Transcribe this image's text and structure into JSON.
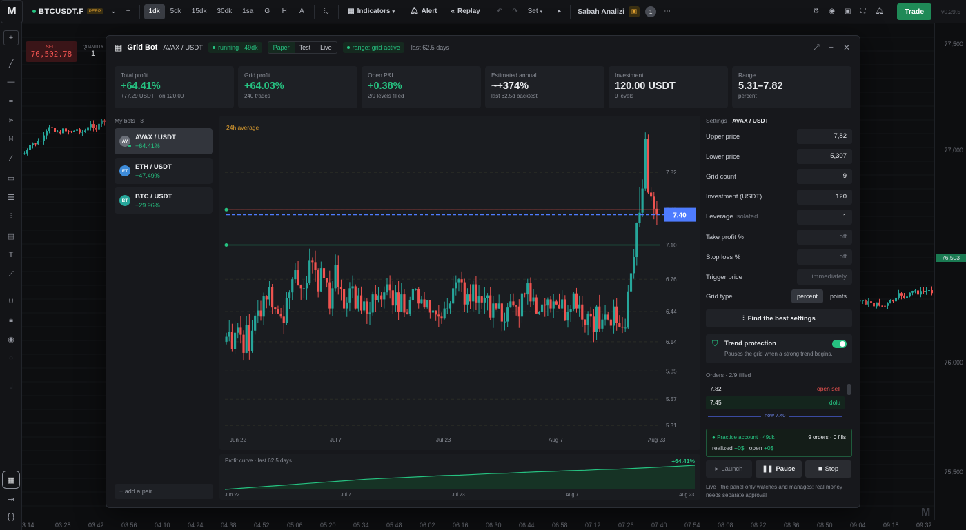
{
  "colors": {
    "up": "#26a69a",
    "down": "#ef5350",
    "accent": "#26c281",
    "blue": "#4e7cff",
    "bg": "#0d0e10"
  },
  "topbar": {
    "logo": "M",
    "symbol": "BTCUSDT.F",
    "symbol_badge": "PERP",
    "intervals": [
      "1dk",
      "5dk",
      "15dk",
      "30dk",
      "1sa",
      "G",
      "H",
      "A"
    ],
    "active_interval": "1dk",
    "indicators": "Indicators",
    "alert": "Alert",
    "replay": "Replay",
    "set": "Set",
    "layout_name": "Sabah Analizi",
    "layout_badge": "1",
    "trade": "Trade",
    "version": "v0.29.5"
  },
  "order_widget": {
    "sell_label": "SELL",
    "sell_price": "76,502.78",
    "qty_label": "QUANTITY",
    "qty_value": "1"
  },
  "price_axis": {
    "labels": [
      "77,500",
      "77,000",
      "76,500",
      "76,000",
      "75,500"
    ],
    "current": "76,503"
  },
  "time_axis": [
    "3:14",
    "03:28",
    "03:42",
    "03:56",
    "04:10",
    "04:24",
    "04:38",
    "04:52",
    "05:06",
    "05:20",
    "05:34",
    "05:48",
    "06:02",
    "06:16",
    "06:30",
    "06:44",
    "06:58",
    "07:12",
    "07:26",
    "07:40",
    "07:54",
    "08:08",
    "08:22",
    "08:36",
    "08:50",
    "09:04",
    "09:18",
    "09:32"
  ],
  "modal": {
    "title": "Grid Bot",
    "pair": "AVAX / USDT",
    "status": "running · 49dk",
    "modes": [
      "Paper",
      "Test",
      "Live"
    ],
    "active_mode": "Paper",
    "range_status": "range: grid active",
    "period": "last 62.5 days",
    "stats": [
      {
        "label": "Total profit",
        "value": "+64.41%",
        "sub": "+77.29 USDT · on 120.00",
        "color": "#26c281"
      },
      {
        "label": "Grid profit",
        "value": "+64.03%",
        "sub": "240 trades",
        "color": "#26c281"
      },
      {
        "label": "Open P&L",
        "value": "+0.38%",
        "sub": "2/9 levels filled",
        "color": "#26c281"
      },
      {
        "label": "Estimated annual",
        "value": "~+374%",
        "sub": "last 62.5d backtest",
        "color": "#e8eaed"
      },
      {
        "label": "Investment",
        "value": "120.00 USDT",
        "sub": "9 levels",
        "color": "#e8eaed"
      },
      {
        "label": "Range",
        "value": "5.31–7.82",
        "sub": "percent",
        "color": "#e8eaed"
      }
    ],
    "bots_header": "My bots · 3",
    "bots": [
      {
        "abbr": "AV",
        "name": "AVAX / USDT",
        "profit": "+64.41%",
        "color": "#6b6f78",
        "active": true
      },
      {
        "abbr": "ET",
        "name": "ETH / USDT",
        "profit": "+47.49%",
        "color": "#3d8bd9",
        "active": false
      },
      {
        "abbr": "BT",
        "name": "BTC / USDT",
        "profit": "+29.96%",
        "color": "#26a69a",
        "active": false
      }
    ],
    "add_pair": "+ add a pair",
    "settings_header": "Settings ·",
    "settings_pair": "AVAX / USDT",
    "fields": [
      {
        "label": "Upper price",
        "value": "7,82",
        "muted": false
      },
      {
        "label": "Lower price",
        "value": "5,307",
        "muted": false
      },
      {
        "label": "Grid count",
        "value": "9",
        "muted": false
      },
      {
        "label": "Investment (USDT)",
        "value": "120",
        "muted": false
      },
      {
        "label": "Leverage",
        "value": "1",
        "muted": false,
        "tag": "isolated"
      },
      {
        "label": "Take profit %",
        "value": "off",
        "muted": true
      },
      {
        "label": "Stop loss %",
        "value": "off",
        "muted": true
      },
      {
        "label": "Trigger price",
        "value": "immediately",
        "muted": true
      }
    ],
    "grid_type": {
      "label": "Grid type",
      "options": [
        "percent",
        "points"
      ],
      "active": "percent"
    },
    "find_best": "Find the best settings",
    "trend": {
      "title": "Trend protection",
      "desc": "Pauses the grid when a strong trend begins.",
      "enabled": true
    },
    "orders_header": "Orders · 2/9 filled",
    "orders": [
      {
        "price": "7.82",
        "status": "open sell",
        "color": "#ef5350"
      },
      {
        "price": "7.45",
        "status": "dolu",
        "color": "#26c281"
      }
    ],
    "now_label": "now 7.40",
    "account": {
      "label": "Practice account · 49dk",
      "summary": "9 orders · 0 fills",
      "realized_label": "realized",
      "realized": "+0$",
      "open_label": "open",
      "open": "+0$"
    },
    "actions": {
      "launch": "Launch",
      "pause": "Pause",
      "stop": "Stop"
    },
    "footnote": "Live · the panel only watches and manages; real money needs separate approval"
  },
  "chart_data": {
    "type": "candlestick",
    "annotation": "24h average",
    "x_labels": [
      "Jun 22",
      "Jul 7",
      "Jul 23",
      "Aug 7",
      "Aug 23"
    ],
    "y_ticks": [
      7.82,
      7.45,
      7.1,
      6.76,
      6.44,
      6.14,
      5.85,
      5.57,
      5.31
    ],
    "ylim": [
      5.25,
      8.3
    ],
    "current_price": 7.4,
    "current_price_label": "7.40",
    "upper_grid_line": 7.45,
    "lower_grid_line": 7.1,
    "closes": [
      6.19,
      6.24,
      6.07,
      6.23,
      6.28,
      6.21,
      6.03,
      6.31,
      6.05,
      6.25,
      6.4,
      6.45,
      6.39,
      6.59,
      6.56,
      6.68,
      6.48,
      6.46,
      6.42,
      6.39,
      6.33,
      6.57,
      6.63,
      6.76,
      6.85,
      6.7,
      6.67,
      6.67,
      6.72,
      6.95,
      6.93,
      6.85,
      6.64,
      6.87,
      6.77,
      6.73,
      6.47,
      6.67,
      6.9,
      6.68,
      6.66,
      6.47,
      6.53,
      6.67,
      6.69,
      6.47,
      6.6,
      6.45,
      6.54,
      6.42,
      6.43,
      6.61,
      6.55,
      6.6,
      6.56,
      6.63,
      6.71,
      6.65,
      6.5,
      6.63,
      6.44,
      6.61,
      6.43,
      6.42,
      6.55,
      6.66,
      6.66,
      6.52,
      6.56,
      6.48,
      6.55,
      6.43,
      6.45,
      6.41,
      6.39,
      6.37,
      6.47,
      6.47,
      6.52,
      6.67,
      6.73,
      6.76,
      6.73,
      6.51,
      6.61,
      6.54,
      6.71,
      6.53,
      6.59,
      6.53,
      6.57,
      6.6,
      6.38,
      6.52,
      6.47,
      6.52,
      6.34,
      6.34,
      6.48,
      6.54,
      6.5,
      6.49,
      6.39,
      6.62,
      6.61,
      6.72,
      6.54,
      6.58,
      6.42,
      6.44,
      6.51,
      6.5,
      6.56,
      6.47,
      6.54,
      6.51,
      6.47,
      6.56,
      6.35,
      6.44,
      6.46,
      6.62,
      6.47,
      6.51,
      6.36,
      6.31,
      6.42,
      6.39,
      6.24,
      6.49,
      6.27,
      6.36,
      6.41,
      6.36,
      6.3,
      6.49,
      6.33,
      6.29,
      6.28,
      6.28,
      6.64,
      6.82,
      6.98,
      7.32,
      7.42,
      7.66,
      8.15,
      7.62,
      7.58,
      7.46,
      7.4
    ],
    "series_name": "AVAX / USDT"
  },
  "profit_curve": {
    "title": "Profit curve · last 62.5 days",
    "value": "+64.41%",
    "x_labels": [
      "Jun 22",
      "Jul 7",
      "Jul 23",
      "Aug 7",
      "Aug 23"
    ],
    "values": [
      0,
      3,
      6,
      9,
      12,
      15,
      18,
      21,
      24,
      27,
      29,
      31,
      33,
      35,
      37,
      38,
      40,
      42,
      43,
      45,
      47,
      48,
      50,
      51,
      53,
      54,
      56,
      58,
      60,
      62,
      64.41
    ]
  }
}
